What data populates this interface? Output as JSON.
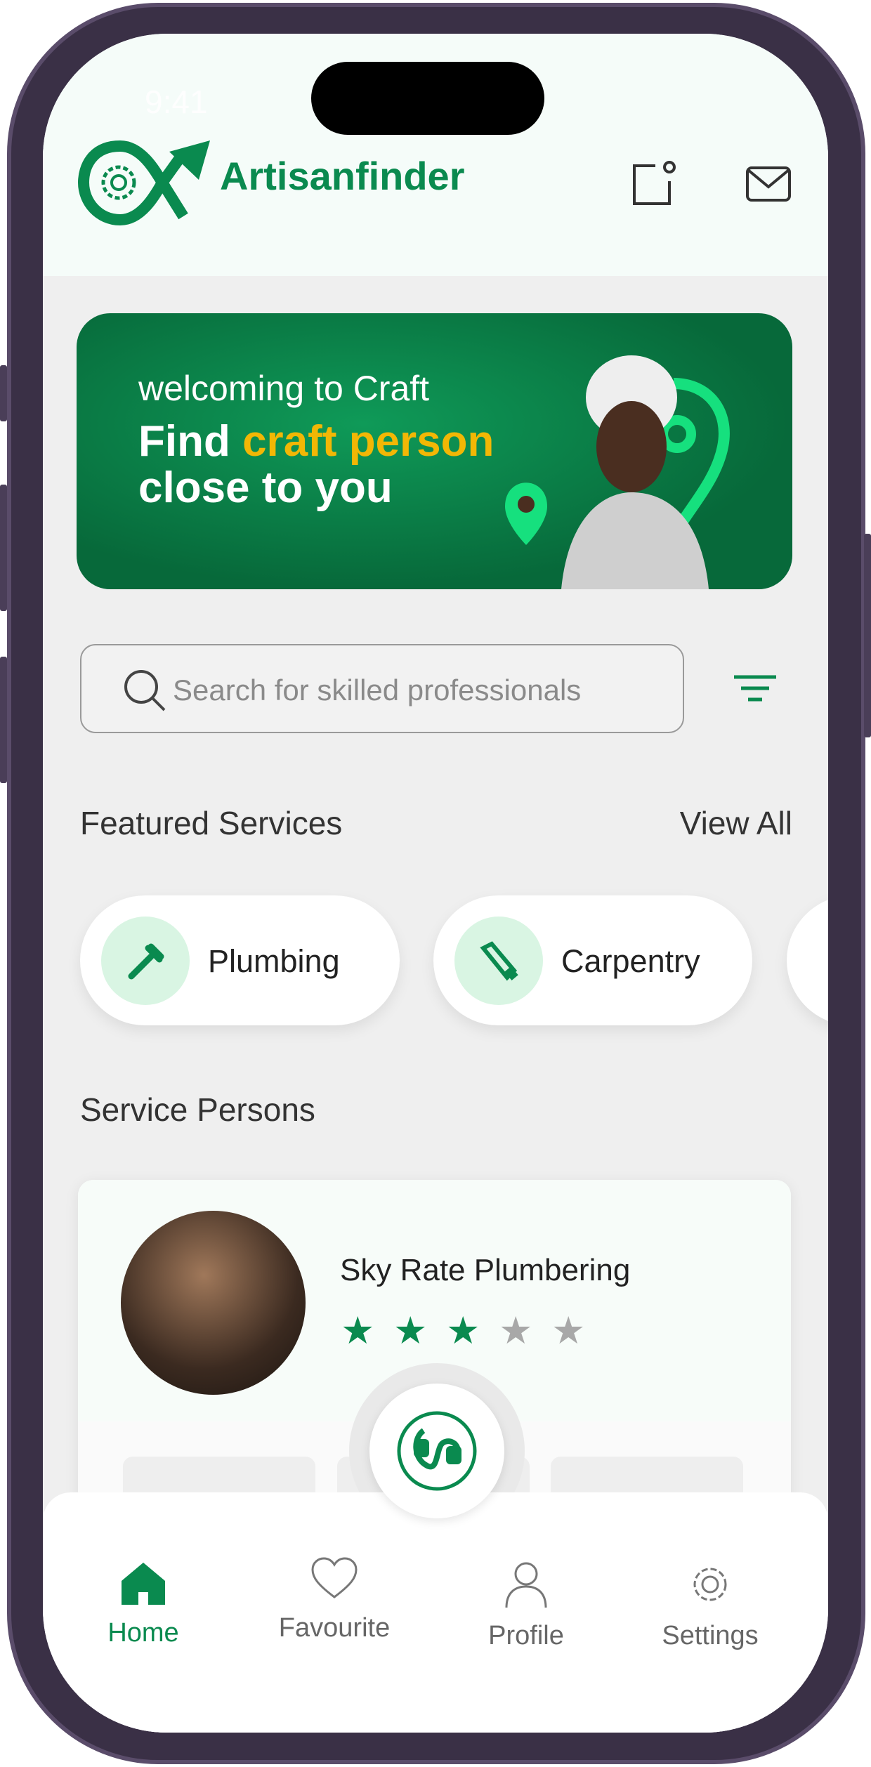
{
  "status_bar": {
    "time": "9:41"
  },
  "header": {
    "brand": "Artisanfinder"
  },
  "banner": {
    "line1": "welcoming to Craft",
    "line2_prefix": "Find ",
    "line2_highlight": "craft person",
    "line3": "close to you"
  },
  "search": {
    "placeholder": "Search for skilled professionals"
  },
  "featured": {
    "title": "Featured Services",
    "view_all": "View All",
    "items": [
      {
        "label": "Plumbing",
        "icon": "wrench-icon"
      },
      {
        "label": "Carpentry",
        "icon": "saw-icon"
      }
    ]
  },
  "service_persons": {
    "title": "Service Persons",
    "items": [
      {
        "name": "Sky Rate Plumbering",
        "rating": 3,
        "max_rating": 5
      }
    ]
  },
  "nav": {
    "items": [
      {
        "label": "Home",
        "active": true
      },
      {
        "label": "Favourite"
      },
      {
        "label": "Profile"
      },
      {
        "label": "Settings"
      }
    ]
  },
  "colors": {
    "brand": "#0a8a4f",
    "accent": "#f2b705",
    "bg": "#efefef"
  }
}
